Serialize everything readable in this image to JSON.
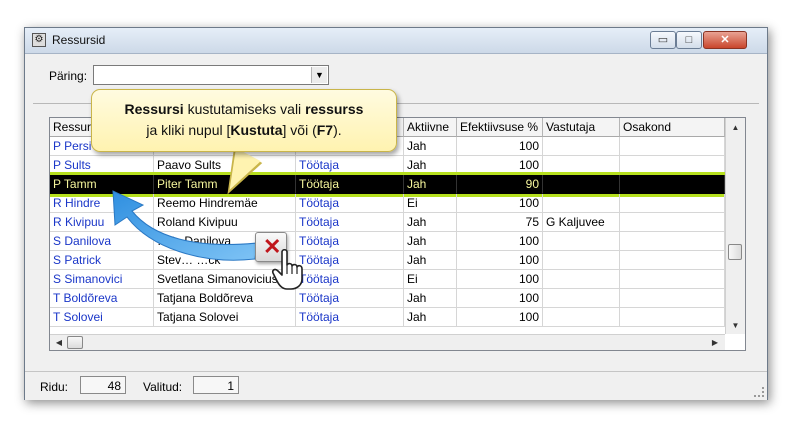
{
  "window": {
    "title": "Ressursid",
    "buttons": {
      "minimize": "▭",
      "maximize": "□",
      "close": "✕"
    }
  },
  "query": {
    "label": "Päring:",
    "value": ""
  },
  "grid": {
    "columns": [
      "Ressursi",
      "",
      "",
      "Aktiivne",
      "Efektiivsuse %",
      "Vastutaja",
      "Osakond"
    ],
    "rows": [
      {
        "c0": "P Persi",
        "c1": "",
        "c2": "",
        "c3": "Jah",
        "c4": "100",
        "c5": "",
        "c6": ""
      },
      {
        "c0": "P Sults",
        "c1": "Paavo Sults",
        "c2": "Töötaja",
        "c3": "Jah",
        "c4": "100",
        "c5": "",
        "c6": ""
      },
      {
        "c0": "P Tamm",
        "c1": "Piter Tamm",
        "c2": "Töötaja",
        "c3": "Jah",
        "c4": "90",
        "c5": "",
        "c6": ""
      },
      {
        "c0": "R Hindre",
        "c1": "Reemo Hindremäe",
        "c2": "Töötaja",
        "c3": "Ei",
        "c4": "100",
        "c5": "",
        "c6": ""
      },
      {
        "c0": "R Kivipuu",
        "c1": "Roland Kivipuu",
        "c2": "Töötaja",
        "c3": "Jah",
        "c4": "75",
        "c5": "G Kaljuvee",
        "c6": ""
      },
      {
        "c0": "S Danilova",
        "c1": "…lla Danilova",
        "c2": "Töötaja",
        "c3": "Jah",
        "c4": "100",
        "c5": "",
        "c6": ""
      },
      {
        "c0": "S Patrick",
        "c1": "Stev… …ck",
        "c2": "Töötaja",
        "c3": "Jah",
        "c4": "100",
        "c5": "",
        "c6": ""
      },
      {
        "c0": "S Simanovici",
        "c1": "Svetlana Simanovicius",
        "c2": "Töötaja",
        "c3": "Ei",
        "c4": "100",
        "c5": "",
        "c6": ""
      },
      {
        "c0": "T Boldõreva",
        "c1": "Tatjana Boldõreva",
        "c2": "Töötaja",
        "c3": "Jah",
        "c4": "100",
        "c5": "",
        "c6": ""
      },
      {
        "c0": "T Solovei",
        "c1": "Tatjana Solovei",
        "c2": "Töötaja",
        "c3": "Jah",
        "c4": "100",
        "c5": "",
        "c6": ""
      }
    ],
    "selected_row": 2
  },
  "status": {
    "rows_label": "Ridu:",
    "rows_value": "48",
    "selected_label": "Valitud:",
    "selected_value": "1"
  },
  "callout": {
    "p1_bold": "Ressursi",
    "p2": " kustutamiseks vali ",
    "p3_bold": "ressurss",
    "p4": "ja kliki nupul [",
    "p5_bold": "Kustuta",
    "p6": "] või (",
    "p7_bold": "F7",
    "p8": ")."
  },
  "colors": {
    "accent_blue": "#1a36c8",
    "selection_bg": "#000000",
    "selection_text": "#f5f59c",
    "highlight": "#b6e01e",
    "callout_bg": "#fff3b0",
    "delete_red": "#c0161c"
  }
}
